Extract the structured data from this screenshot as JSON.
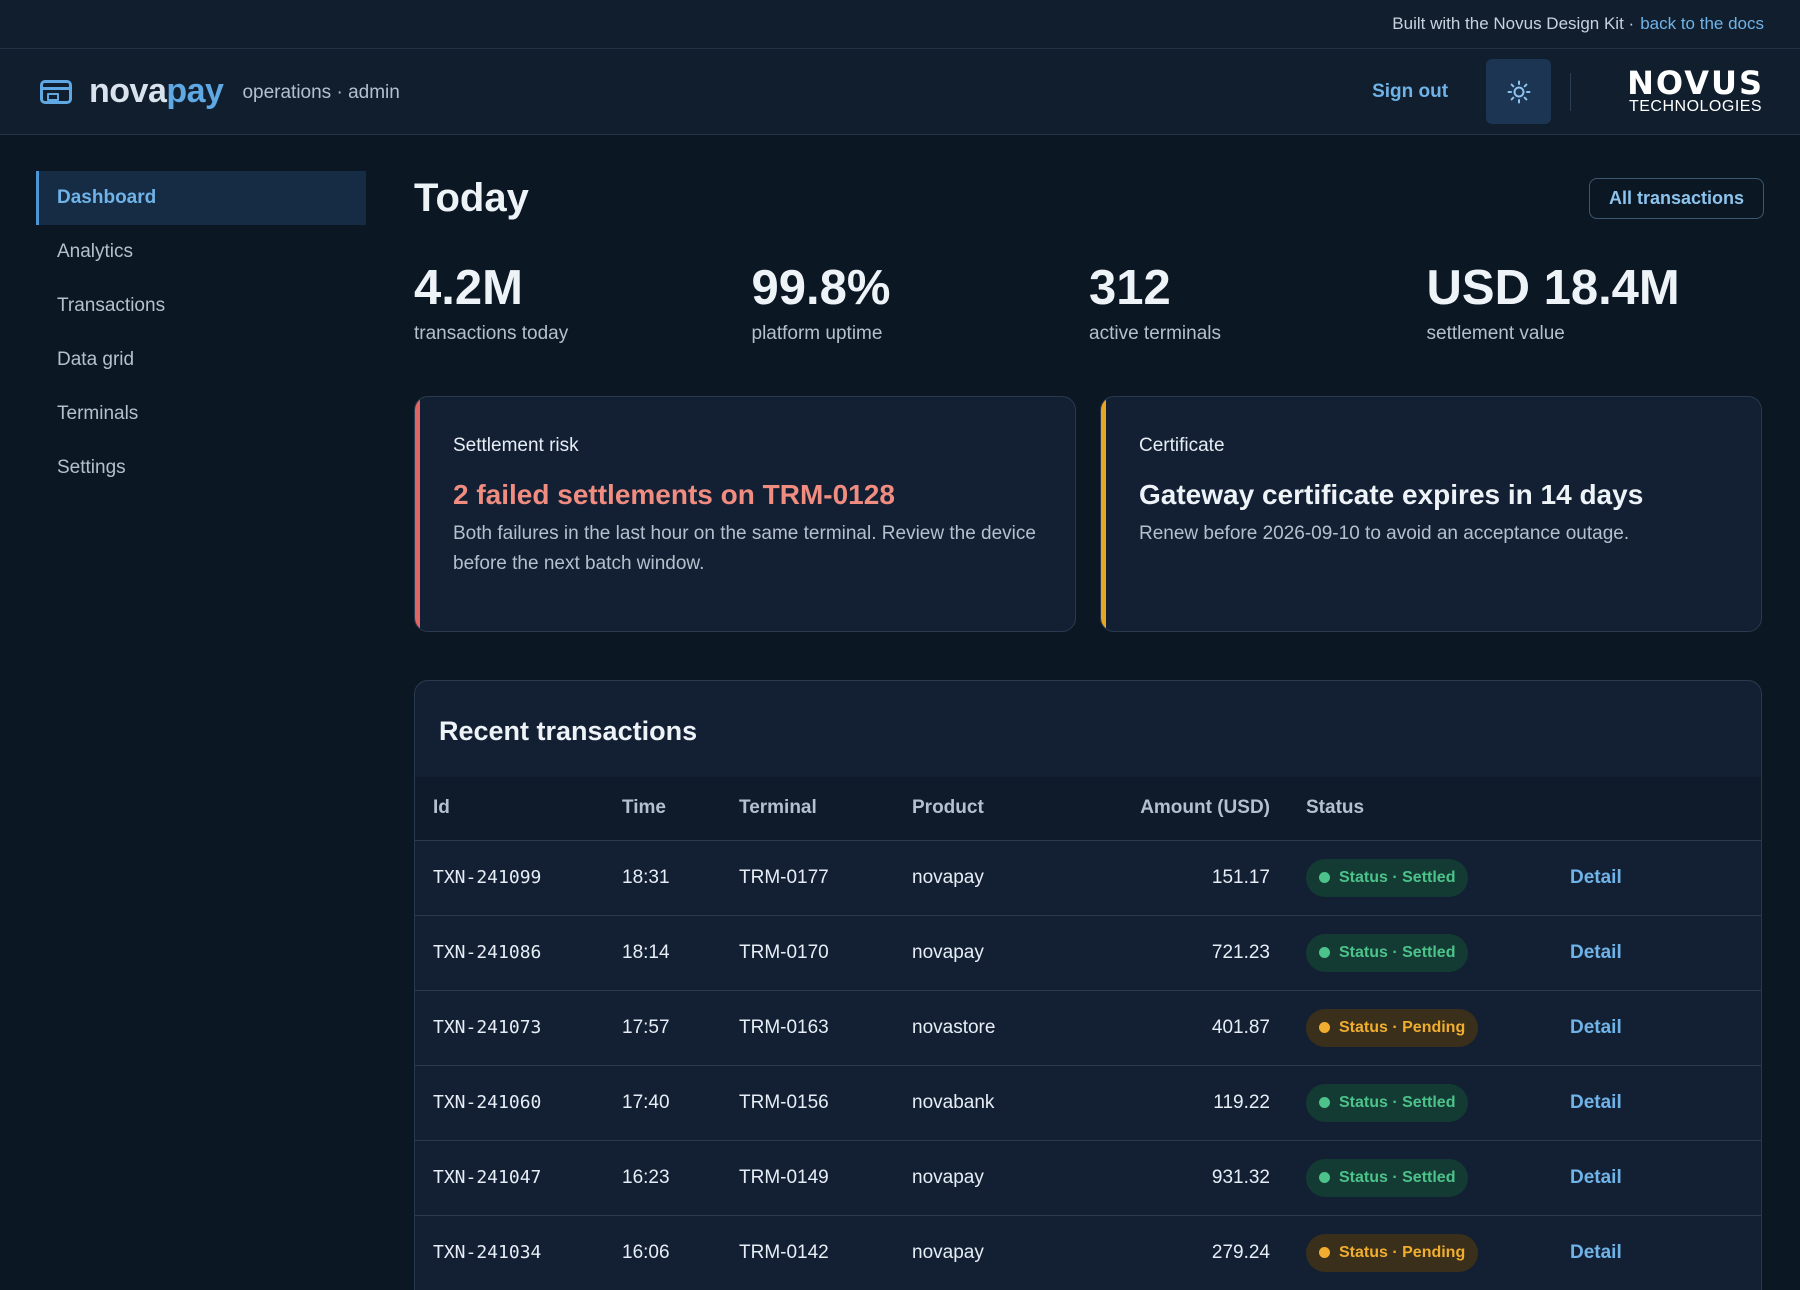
{
  "topbar": {
    "text": "Built with the Novus Design Kit ·",
    "docs_link": "back to the docs"
  },
  "header": {
    "brand_prefix": "nova",
    "brand_suffix": "pay",
    "subtitle": "operations · admin",
    "signout": "Sign out",
    "theme_icon": "sun-icon",
    "logo_main": "NOVUS",
    "logo_sub": "TECHNOLOGIES"
  },
  "sidebar": {
    "items": [
      {
        "label": "Dashboard",
        "active": true
      },
      {
        "label": "Analytics"
      },
      {
        "label": "Transactions"
      },
      {
        "label": "Data grid"
      },
      {
        "label": "Terminals"
      },
      {
        "label": "Settings"
      }
    ]
  },
  "main": {
    "title": "Today",
    "all_button": "All transactions",
    "kpis": [
      {
        "value": "4.2M",
        "label": "transactions today"
      },
      {
        "value": "99.8%",
        "label": "platform uptime"
      },
      {
        "value": "312",
        "label": "active terminals"
      },
      {
        "value": "USD 18.4M",
        "label": "settlement value"
      }
    ],
    "alerts": [
      {
        "kicker": "Settlement risk",
        "title": "2 failed settlements on TRM-0128",
        "body": "Both failures in the last hour on the same terminal. Review the device before the next batch window.",
        "color": "#e06666"
      },
      {
        "kicker": "Certificate",
        "title": "Gateway certificate expires in 14 days",
        "body": "Renew before 2026-09-10 to avoid an acceptance outage.",
        "color": "#e8a521"
      }
    ]
  },
  "table": {
    "title": "Recent transactions",
    "columns": [
      "Id",
      "Time",
      "Terminal",
      "Product",
      "Amount (USD)",
      "Status"
    ],
    "rows": [
      {
        "id": "TXN-241099",
        "time": "18:31",
        "terminal": "TRM-0177",
        "product": "novapay",
        "amount": "151.17",
        "status": "Status · Settled",
        "detail": "Detail"
      },
      {
        "id": "TXN-241086",
        "time": "18:14",
        "terminal": "TRM-0170",
        "product": "novapay",
        "amount": "721.23",
        "status": "Status · Settled",
        "detail": "Detail"
      },
      {
        "id": "TXN-241073",
        "time": "17:57",
        "terminal": "TRM-0163",
        "product": "novastore",
        "amount": "401.87",
        "status": "Status · Pending",
        "detail": "Detail"
      },
      {
        "id": "TXN-241060",
        "time": "17:40",
        "terminal": "TRM-0156",
        "product": "novabank",
        "amount": "119.22",
        "status": "Status · Settled",
        "detail": "Detail"
      },
      {
        "id": "TXN-241047",
        "time": "16:23",
        "terminal": "TRM-0149",
        "product": "novapay",
        "amount": "931.32",
        "status": "Status · Settled",
        "detail": "Detail"
      },
      {
        "id": "TXN-241034",
        "time": "16:06",
        "terminal": "TRM-0142",
        "product": "novapay",
        "amount": "279.24",
        "status": "Status · Pending",
        "detail": "Detail"
      }
    ]
  },
  "colors": {
    "accent": "#6fb3e8",
    "settled": "#4cc38a",
    "pending": "#f0ad30",
    "danger": "#f08c80"
  }
}
